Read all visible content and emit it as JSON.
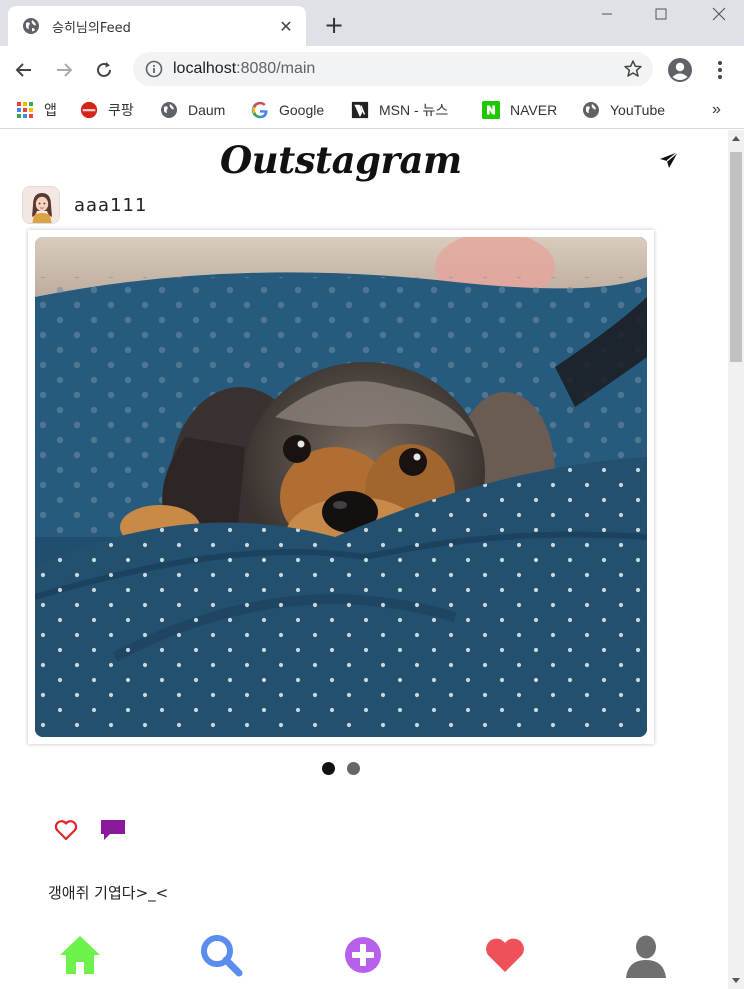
{
  "browser": {
    "tab_title": "승히님의Feed",
    "tab_close": "✕",
    "new_tab": "+",
    "url_host": "localhost",
    "url_rest": ":8080/main",
    "bookmarks": [
      {
        "label": "앱",
        "icon": "apps-grid-icon"
      },
      {
        "label": "쿠팡",
        "icon": "coupang-icon"
      },
      {
        "label": "Daum",
        "icon": "globe-icon"
      },
      {
        "label": "Google",
        "icon": "google-icon"
      },
      {
        "label": "MSN - 뉴스",
        "icon": "msn-icon"
      },
      {
        "label": "NAVER",
        "icon": "naver-icon"
      },
      {
        "label": "YouTube",
        "icon": "globe-icon"
      }
    ],
    "bookmarks_more": "»"
  },
  "app": {
    "brand": "Outstagram",
    "post": {
      "username": "aaa111",
      "caption": "갱애쥐 기엽다>_<",
      "carousel_total": 2,
      "carousel_active": 1
    },
    "nav": [
      {
        "name": "home",
        "color": "#6cf24a"
      },
      {
        "name": "search",
        "color": "#5b8def"
      },
      {
        "name": "add",
        "color": "#b660ec"
      },
      {
        "name": "likes",
        "color": "#f0505a"
      },
      {
        "name": "profile",
        "color": "#6f6f6f"
      }
    ],
    "colors": {
      "like_heart": "#e0242c",
      "comment": "#8b1a9a"
    }
  }
}
